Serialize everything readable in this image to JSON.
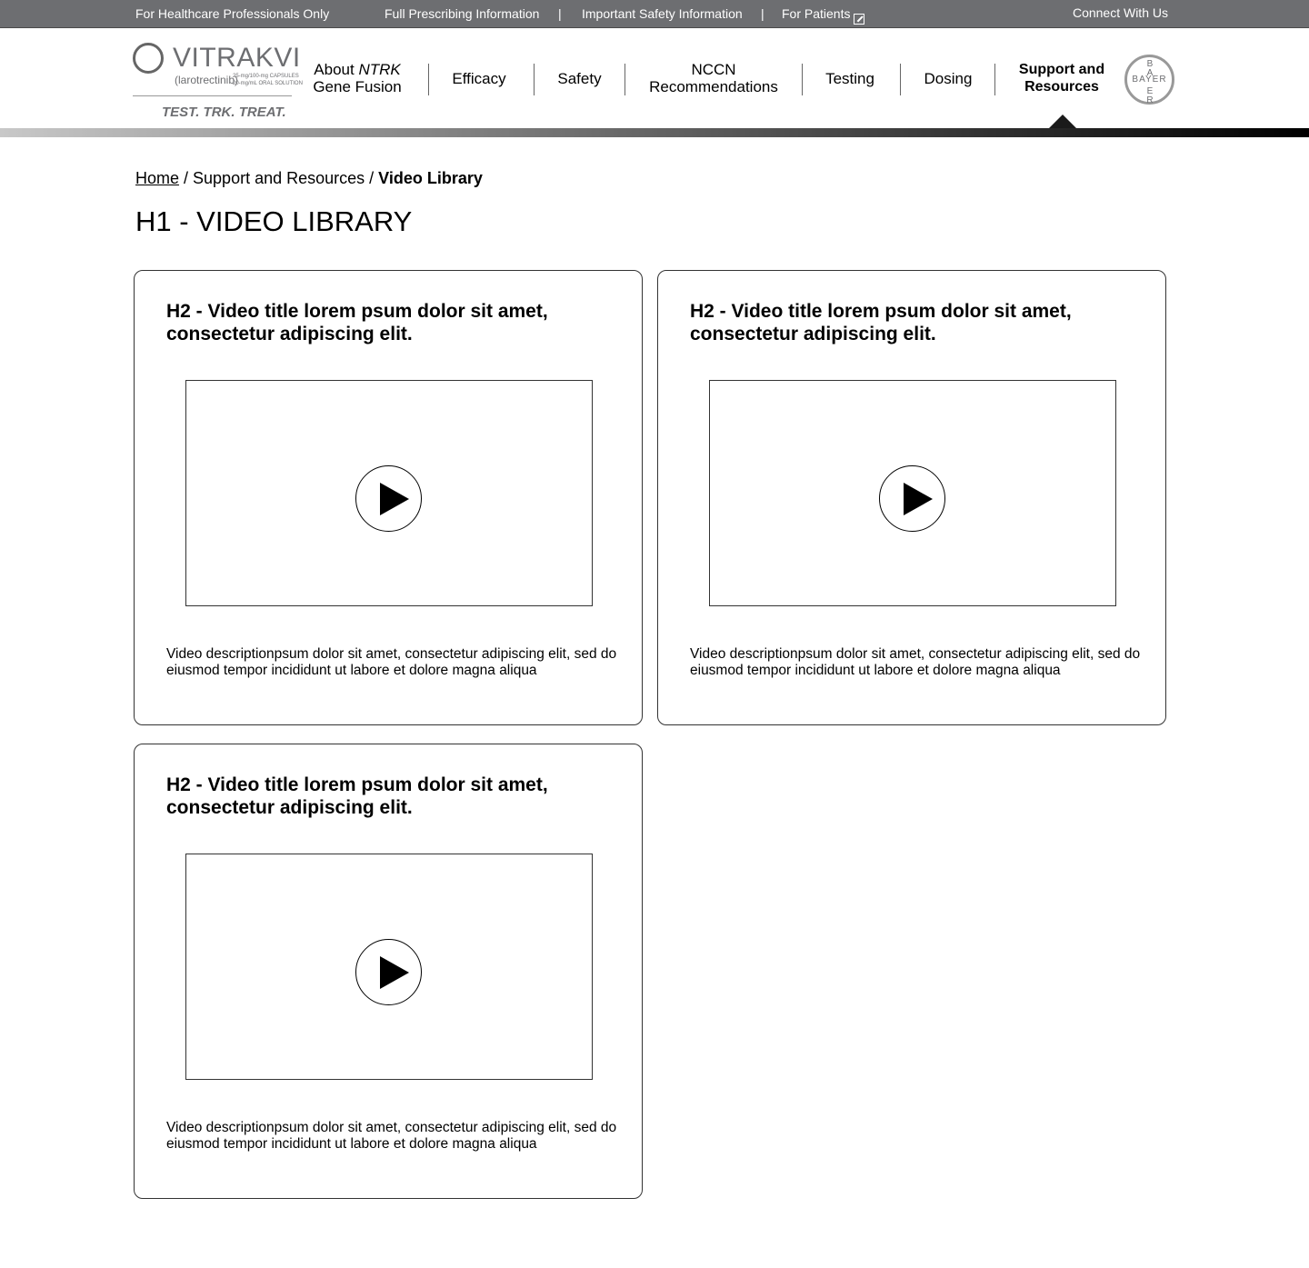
{
  "topbar": {
    "hcp_only": "For Healthcare Professionals Only",
    "full_prescribing": "Full Prescribing Information",
    "separator": "|",
    "safety_info": "Important Safety Information",
    "for_patients": "For Patients",
    "connect": "Connect With Us"
  },
  "logo": {
    "name": "VITRAKVI",
    "generic": "(larotrectinib)",
    "dose_line1": "25-mg/100-mg CAPSULES",
    "dose_line2": "20-mg/mL ORAL SOLUTION",
    "tagline": "TEST. TRK. TREAT."
  },
  "nav": {
    "about_prefix": "About ",
    "about_italic": "NTRK",
    "about_line2": "Gene Fusion",
    "efficacy": "Efficacy",
    "safety": "Safety",
    "nccn_line1": "NCCN",
    "nccn_line2": "Recommendations",
    "testing": "Testing",
    "dosing": "Dosing",
    "support_line1": "Support and",
    "support_line2": "Resources",
    "active": "Support and Resources"
  },
  "bayer": {
    "horizontal": "BAYER",
    "vertical": [
      "B",
      "A",
      "E",
      "R"
    ]
  },
  "breadcrumb": {
    "home": "Home",
    "sep": " / ",
    "section": "Support and Resources",
    "current": "Video Library"
  },
  "page": {
    "title": "H1 - VIDEO LIBRARY"
  },
  "videos": [
    {
      "title": "H2 - Video title lorem psum dolor sit amet, consectetur adipiscing elit.",
      "description": "Video descriptionpsum dolor sit amet, consectetur adipiscing elit, sed do eiusmod tempor incididunt ut labore et dolore magna aliqua"
    },
    {
      "title": "H2 - Video title lorem psum dolor sit amet, consectetur adipiscing elit.",
      "description": "Video descriptionpsum dolor sit amet, consectetur adipiscing elit, sed do eiusmod tempor incididunt ut labore et dolore magna aliqua"
    },
    {
      "title": "H2 - Video title lorem psum dolor sit amet, consectetur adipiscing elit.",
      "description": "Video descriptionpsum dolor sit amet, consectetur adipiscing elit, sed do eiusmod tempor incididunt ut labore et dolore magna aliqua"
    }
  ],
  "icons": {
    "external": "external-link-icon",
    "play": "play-icon",
    "logo_mark": "vitrakvi-logo-icon",
    "bayer": "bayer-cross-icon"
  },
  "colors": {
    "topbar_bg": "#6d6e71",
    "text": "#000000",
    "logo_gray": "#6d6e71"
  }
}
